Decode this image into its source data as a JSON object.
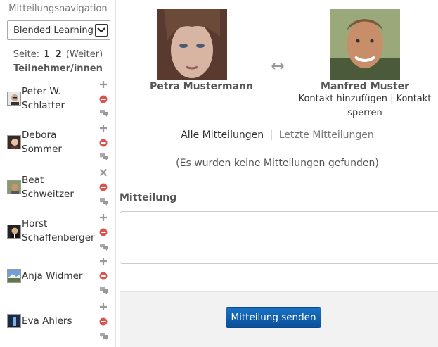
{
  "sidebar": {
    "heading": "Mitteilungsnavigation",
    "course_select": {
      "value": "Blended Learning"
    },
    "pager": {
      "label": "Seite:",
      "page1": "1",
      "page2": "2",
      "next": "(Weiter)"
    },
    "participants_heading": "Teilnehmer/innen",
    "contacts": [
      {
        "name_line1": "Peter W.",
        "name_line2": "Schlatter",
        "action1": "add-icon",
        "action2": "block-icon",
        "action3": "history-icon"
      },
      {
        "name_line1": "Debora",
        "name_line2": "Sommer",
        "action1": "add-icon",
        "action2": "block-icon",
        "action3": "history-icon"
      },
      {
        "name_line1": "Beat",
        "name_line2": "Schweitzer",
        "action1": "remove-icon",
        "action2": "block-icon",
        "action3": "history-icon"
      },
      {
        "name_line1": "Horst",
        "name_line2": "Schaffenberger",
        "action1": "add-icon",
        "action2": "block-icon",
        "action3": "history-icon"
      },
      {
        "name_line1": "Anja Widmer",
        "name_line2": "",
        "action1": "add-icon",
        "action2": "block-icon",
        "action3": "history-icon"
      },
      {
        "name_line1": "Eva Ahlers",
        "name_line2": "",
        "action1": "add-icon",
        "action2": "block-icon",
        "action3": "history-icon"
      }
    ]
  },
  "conversation": {
    "user_left": {
      "name": "Petra Mustermann"
    },
    "user_right": {
      "name": "Manfred Muster",
      "add_contact": "Kontakt hinzufügen",
      "separator": "|",
      "block_contact_line1": "Kontakt",
      "block_contact_line2": "sperren"
    },
    "tabs": {
      "all": "Alle Mitteilungen",
      "separator": "|",
      "recent": "Letzte Mitteilungen"
    },
    "empty_message": "(Es wurden keine Mitteilungen gefunden)"
  },
  "compose": {
    "label": "Mitteilung",
    "message_value": "",
    "send_label": "Mitteilung senden"
  },
  "colors": {
    "send_button": "#0b5cab",
    "block_icon": "#d9534f",
    "action_icon": "#999999"
  }
}
